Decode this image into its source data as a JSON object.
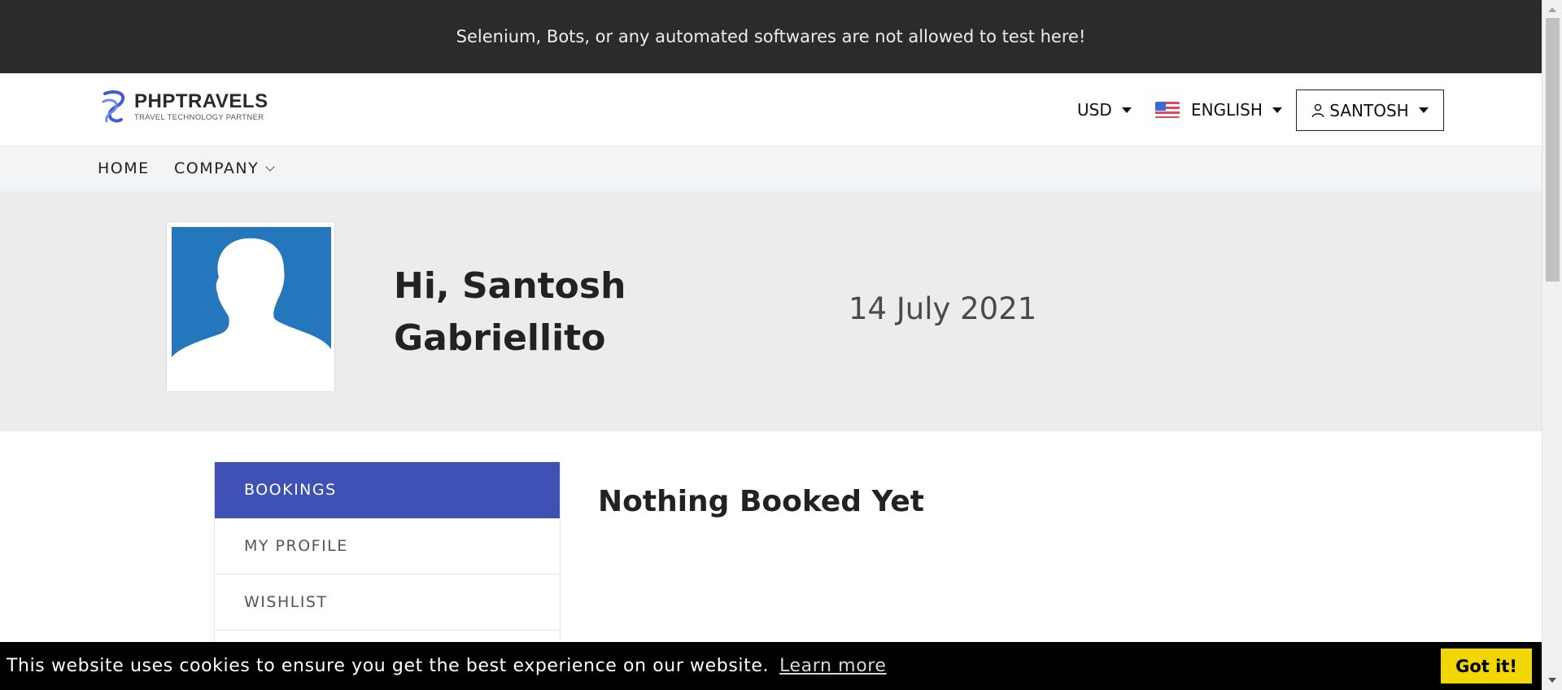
{
  "notice": {
    "text": "Selenium, Bots, or any automated softwares are not allowed to test here!"
  },
  "header": {
    "logo": {
      "name": "PHPTRAVELS",
      "tagline": "TRAVEL TECHNOLOGY PARTNER"
    },
    "currency": "USD",
    "language": "ENGLISH",
    "account": "SANTOSH",
    "icons": {
      "language_flag": "us-flag-icon",
      "account": "user-icon"
    }
  },
  "nav": {
    "home": "HOME",
    "company": "COMPANY"
  },
  "profile": {
    "greeting_line1": "Hi, Santosh",
    "greeting_line2": "Gabriellito",
    "date": "14 July 2021"
  },
  "sidebar": {
    "items": [
      {
        "label": "BOOKINGS",
        "active": true
      },
      {
        "label": "MY PROFILE",
        "active": false
      },
      {
        "label": "WISHLIST",
        "active": false
      }
    ]
  },
  "main": {
    "empty_title": "Nothing Booked Yet"
  },
  "cookie": {
    "message": "This website uses cookies to ensure you get the best experience on our website.",
    "link": "Learn more",
    "button": "Got it!"
  },
  "colors": {
    "notice_bg": "#2b2b2b",
    "accent": "#3f51b5",
    "avatar_bg": "#2577bd",
    "cookie_button": "#f1d600"
  }
}
